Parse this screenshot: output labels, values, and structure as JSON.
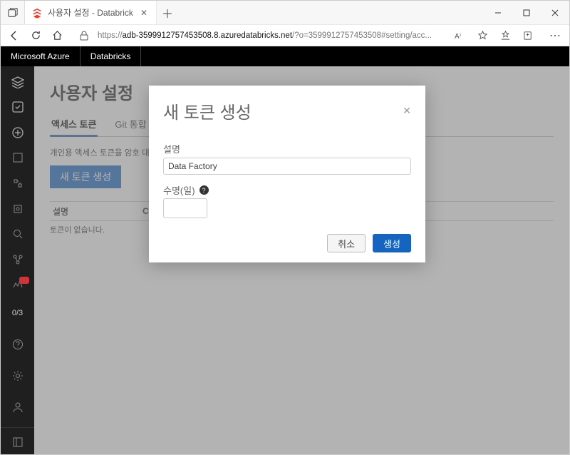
{
  "browser": {
    "tab_title": "사용자 설정 - Databricks",
    "url_lock_host": "adb-3599912757453508.8.azuredatabricks.net",
    "url_path": "/?o=3599912757453508#setting/acc..."
  },
  "azurenav": {
    "azure": "Microsoft Azure",
    "databricks": "Databricks"
  },
  "sidebar": {
    "progress": "0/3"
  },
  "page": {
    "title": "사용자 설정",
    "tabs": {
      "access": "액세스 토큰",
      "git": "Git 통합"
    },
    "desc": "개인용 액세스 토큰을 암호 대신",
    "new_button": "새 토큰 생성",
    "col_comment": "설명",
    "col_created": "Cre",
    "empty": "토큰이 없습니다."
  },
  "modal": {
    "title": "새 토큰 생성",
    "comment_label": "설명",
    "comment_value": "Data Factory",
    "lifetime_label": "수명(일)",
    "lifetime_value": "",
    "cancel": "취소",
    "create": "생성"
  }
}
